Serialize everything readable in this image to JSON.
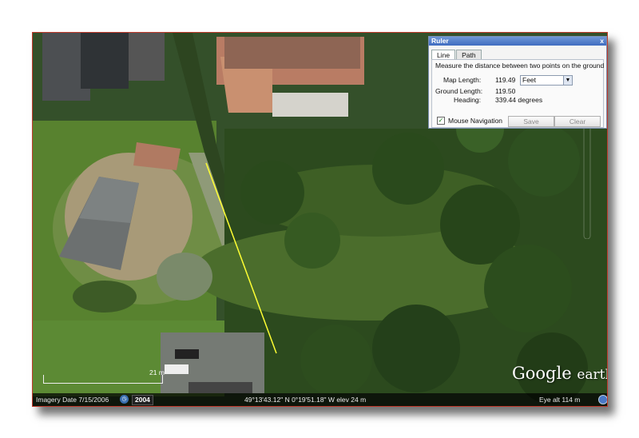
{
  "ruler": {
    "title": "Ruler",
    "close": "x",
    "tabs": [
      "Line",
      "Path"
    ],
    "description": "Measure the distance between two points on the ground",
    "map_length_label": "Map Length:",
    "map_length_value": "119.49",
    "units": "Feet",
    "ground_length_label": "Ground Length:",
    "ground_length_value": "119.50",
    "heading_label": "Heading:",
    "heading_value": "339.44 degrees",
    "mouse_nav_label": "Mouse Navigation",
    "mouse_nav_checked": true,
    "save_label": "Save",
    "clear_label": "Clear"
  },
  "status": {
    "imagery_date": "Imagery Date  7/15/2006",
    "year_badge": "2004",
    "coordinates": "49°13'43.12\" N   0°19'51.18\" W  elev   24 m",
    "eye_alt": "Eye alt   114 m"
  },
  "branding": {
    "google": "Google",
    "earth": "earth"
  },
  "scale_label": "21 m",
  "measure_line_color": "#ffff33"
}
